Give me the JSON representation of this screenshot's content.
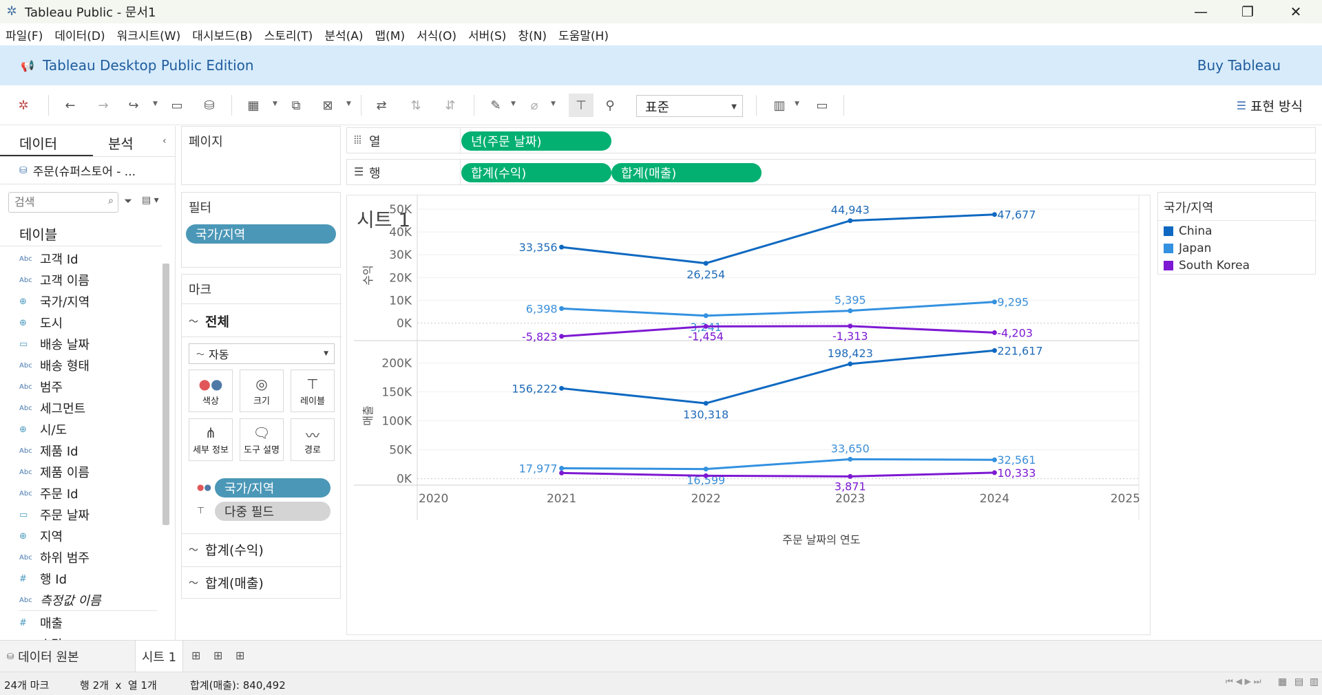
{
  "window": {
    "title": "Tableau Public - 문서1"
  },
  "menu": [
    "파일(F)",
    "데이터(D)",
    "워크시트(W)",
    "대시보드(B)",
    "스토리(T)",
    "분석(A)",
    "맵(M)",
    "서식(O)",
    "서버(S)",
    "창(N)",
    "도움말(H)"
  ],
  "banner": {
    "title": "Tableau Desktop Public Edition",
    "buy": "Buy Tableau"
  },
  "toolbar": {
    "fit": "표준",
    "show_me": "표현 방식"
  },
  "datapane": {
    "tab_data": "데이터",
    "tab_analysis": "분석",
    "datasource": "주문(슈퍼스토어 - ...",
    "search_placeholder": "검색",
    "tables_heading": "테이블",
    "fields": [
      {
        "type": "Abc",
        "name": "고객 Id"
      },
      {
        "type": "Abc",
        "name": "고객 이름"
      },
      {
        "type": "geo",
        "name": "국가/지역"
      },
      {
        "type": "geo",
        "name": "도시"
      },
      {
        "type": "date",
        "name": "배송 날짜"
      },
      {
        "type": "Abc",
        "name": "배송 형태"
      },
      {
        "type": "Abc",
        "name": "범주"
      },
      {
        "type": "Abc",
        "name": "세그먼트"
      },
      {
        "type": "geo",
        "name": "시/도"
      },
      {
        "type": "Abc",
        "name": "제품 Id"
      },
      {
        "type": "Abc",
        "name": "제품 이름"
      },
      {
        "type": "Abc",
        "name": "주문 Id"
      },
      {
        "type": "date",
        "name": "주문 날짜"
      },
      {
        "type": "geo",
        "name": "지역"
      },
      {
        "type": "Abc",
        "name": "하위 범주"
      },
      {
        "type": "#",
        "name": "행 Id"
      },
      {
        "type": "Abc",
        "name": "측정값 이름"
      }
    ],
    "measures": [
      {
        "type": "#",
        "name": "매출"
      },
      {
        "type": "#",
        "name": "수량"
      }
    ]
  },
  "shelves": {
    "pages_label": "페이지",
    "filters_label": "필터",
    "filter_pill": "국가/지역",
    "columns_label": "열",
    "rows_label": "행",
    "columns_pill": "년(주문 날짜)",
    "rows_pills": [
      "합계(수익)",
      "합계(매출)"
    ]
  },
  "marks": {
    "label": "마크",
    "all": "전체",
    "type": "자동",
    "buttons": [
      "색상",
      "크기",
      "레이블",
      "세부 정보",
      "도구 설명",
      "경로"
    ],
    "encodings": [
      "국가/지역",
      "다중 필드"
    ],
    "cards": [
      "합계(수익)",
      "합계(매출)"
    ]
  },
  "sheet": {
    "title": "시트 1"
  },
  "legend": {
    "title": "국가/지역",
    "items": [
      {
        "name": "China",
        "color": "#0f69c1"
      },
      {
        "name": "Japan",
        "color": "#3391e0"
      },
      {
        "name": "South Korea",
        "color": "#7d19d2"
      }
    ]
  },
  "chart_data": {
    "type": "line",
    "xlabel": "주문 날짜의 연도",
    "x_ticks": [
      "2020",
      "2021",
      "2022",
      "2023",
      "2024",
      "2025"
    ],
    "x": [
      2021,
      2022,
      2023,
      2024
    ],
    "xlim": [
      2020,
      2025
    ],
    "panes": [
      {
        "ylabel": "수익",
        "ylim": [
          -8000,
          50000
        ],
        "y_ticks": [
          "50K",
          "40K",
          "30K",
          "20K",
          "10K",
          "0K"
        ],
        "y_tick_values": [
          50000,
          40000,
          30000,
          20000,
          10000,
          0
        ],
        "series": [
          {
            "name": "China",
            "values": [
              33356,
              26254,
              44943,
              47677
            ],
            "labels": [
              "33,356",
              "26,254",
              "44,943",
              "47,677"
            ]
          },
          {
            "name": "Japan",
            "values": [
              6398,
              3241,
              5395,
              9295
            ],
            "labels": [
              "6,398",
              "3,241",
              "5,395",
              "9,295"
            ]
          },
          {
            "name": "South Korea",
            "values": [
              -5823,
              -1454,
              -1313,
              -4203
            ],
            "labels": [
              "-5,823",
              "-1,454",
              "-1,313",
              "-4,203"
            ]
          }
        ]
      },
      {
        "ylabel": "매출",
        "ylim": [
          -10000,
          228000
        ],
        "y_ticks": [
          "200K",
          "150K",
          "100K",
          "50K",
          "0K"
        ],
        "y_tick_values": [
          200000,
          150000,
          100000,
          50000,
          0
        ],
        "series": [
          {
            "name": "China",
            "values": [
              156222,
              130318,
              198423,
              221617
            ],
            "labels": [
              "156,222",
              "130,318",
              "198,423",
              "221,617"
            ]
          },
          {
            "name": "Japan",
            "values": [
              17977,
              16599,
              33650,
              32561
            ],
            "labels": [
              "17,977",
              "16,599",
              "33,650",
              "32,561"
            ]
          },
          {
            "name": "South Korea",
            "values": [
              9800,
              5000,
              3871,
              10333
            ],
            "labels": [
              "",
              "",
              "3,871",
              "10,333"
            ]
          }
        ]
      }
    ]
  },
  "bottom": {
    "datasource_tab": "데이터 원본",
    "sheet_tab": "시트 1"
  },
  "status": {
    "marks": "24개 마크",
    "grid": "행 2개  x  열 1개",
    "sum": "합계(매출): 840,492"
  }
}
